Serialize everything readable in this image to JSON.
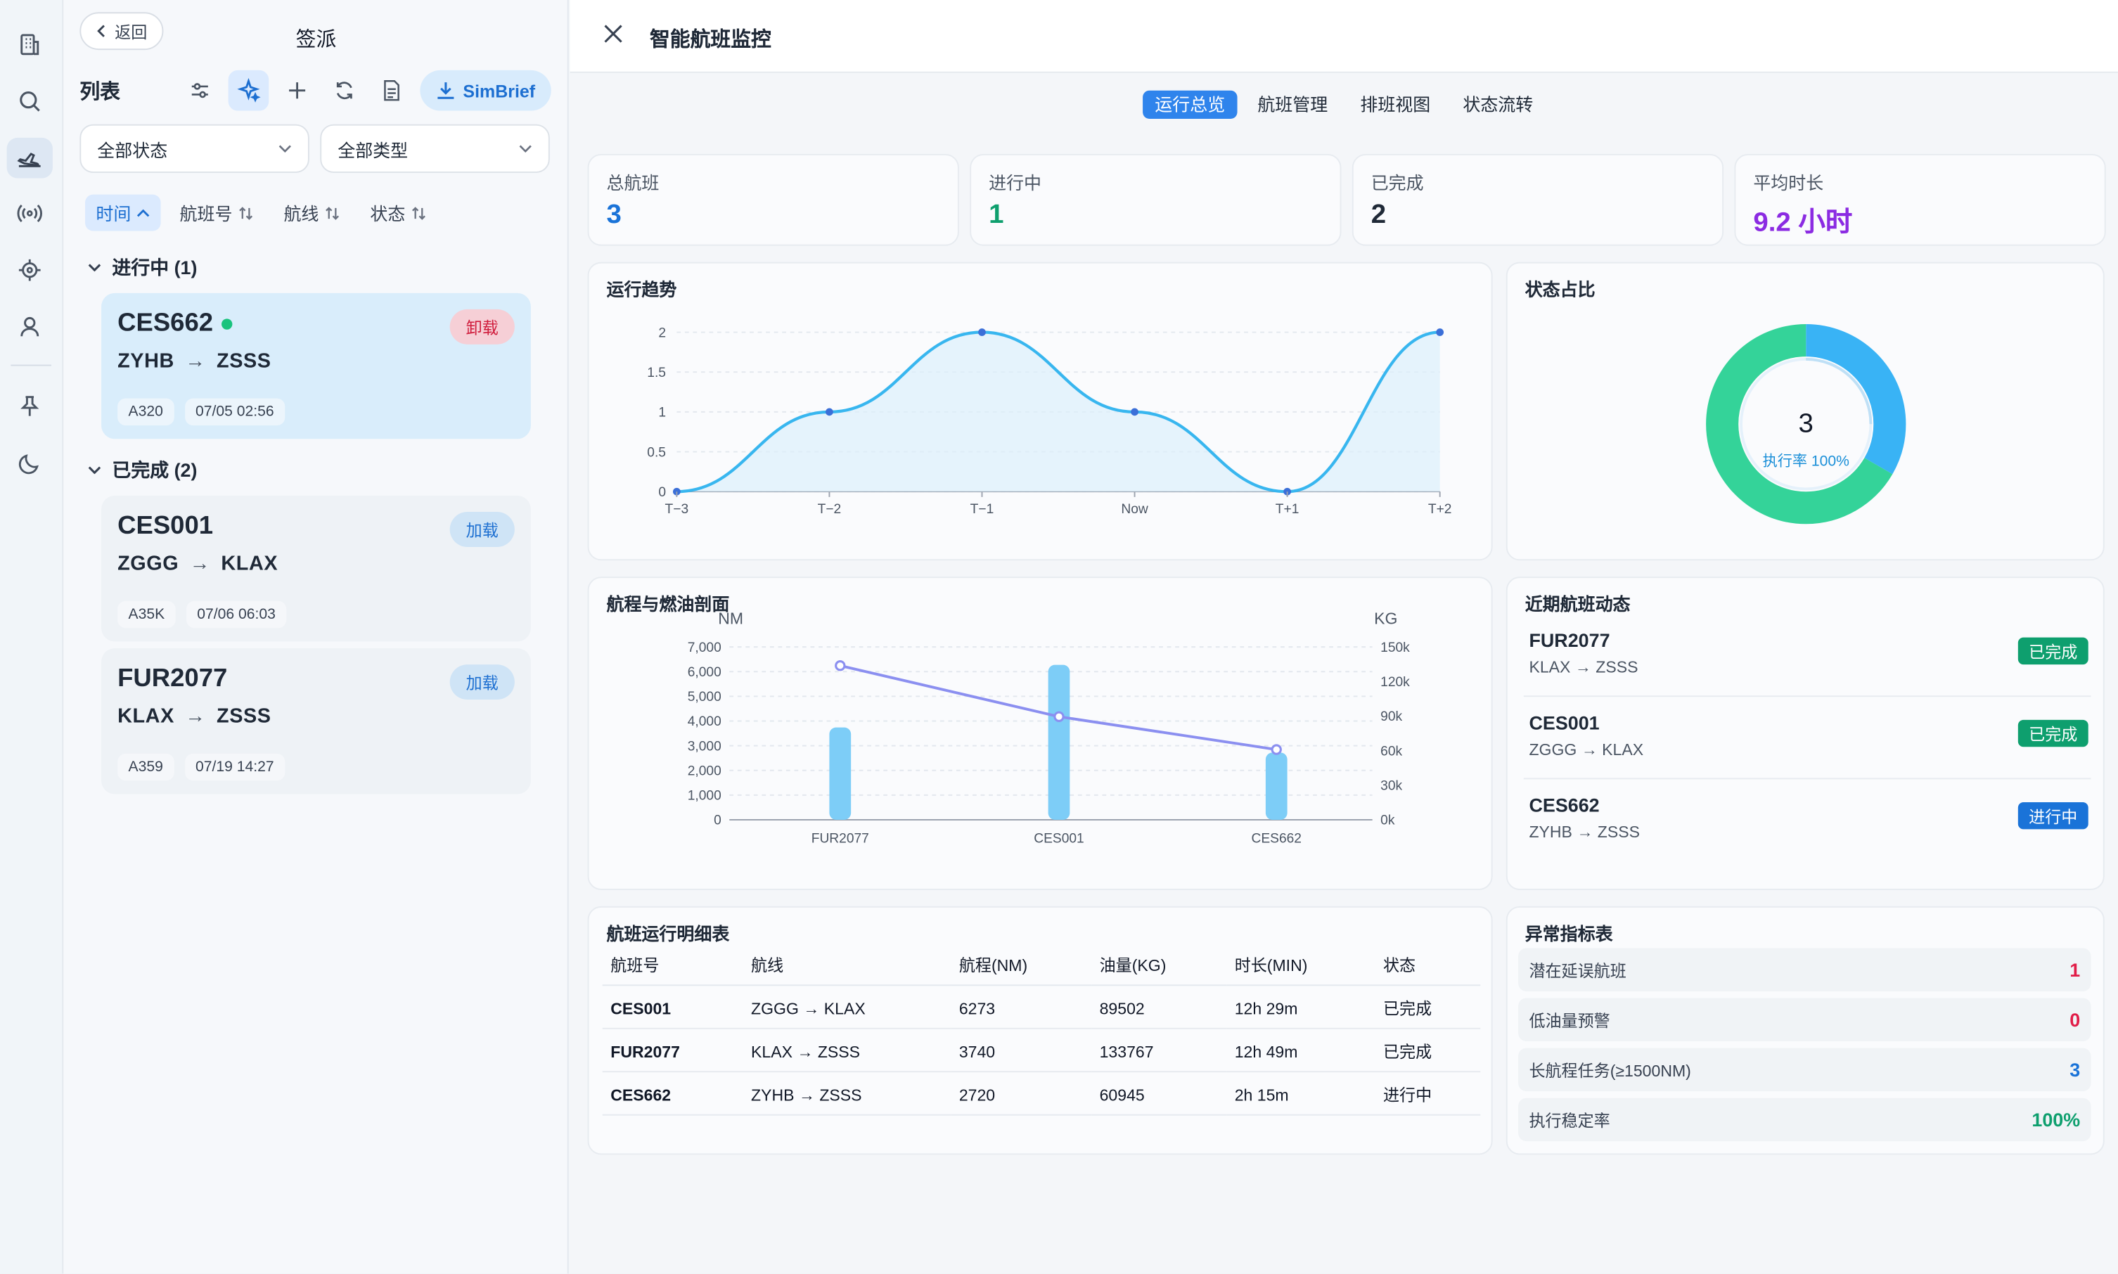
{
  "sidebar": {
    "label": "签派",
    "back_label": "返回",
    "list_label": "列表",
    "simbrief_label": "SimBrief"
  },
  "filters": {
    "status": "全部状态",
    "type": "全部类型"
  },
  "sort_tabs": [
    "时间",
    "航班号",
    "航线",
    "状态"
  ],
  "groups": [
    {
      "title": "进行中 (1)",
      "flights": [
        {
          "flight": "CES662",
          "origin": "ZYHB",
          "dest": "ZSSS",
          "aircraft": "A320",
          "time": "07/05 02:56",
          "badge": "卸载"
        }
      ]
    },
    {
      "title": "已完成 (2)",
      "flights": [
        {
          "flight": "CES001",
          "origin": "ZGGG",
          "dest": "KLAX",
          "aircraft": "A35K",
          "time": "07/06 06:03",
          "badge": "加载"
        },
        {
          "flight": "FUR2077",
          "origin": "KLAX",
          "dest": "ZSSS",
          "aircraft": "A359",
          "time": "07/19 14:27",
          "badge": "加载"
        }
      ]
    }
  ],
  "route_arrow": "→",
  "main": {
    "title": "智能航班监控",
    "tabs": [
      "运行总览",
      "航班管理",
      "排班视图",
      "状态流转"
    ]
  },
  "kpis": [
    {
      "label": "总航班",
      "value": "3",
      "color": "#1a73d8"
    },
    {
      "label": "进行中",
      "value": "1",
      "color": "#0e9f6e"
    },
    {
      "label": "已完成",
      "value": "2",
      "color": "#1f2937"
    },
    {
      "label": "平均时长",
      "value": "9.2 小时",
      "color": "#8b2be2"
    }
  ],
  "panels": {
    "trend": "运行趋势",
    "status": "状态占比",
    "profile": "航程与燃油剖面",
    "recent": "近期航班动态",
    "detail": "航班运行明细表",
    "anomaly": "异常指标表"
  },
  "donut": {
    "total": "3",
    "caption": "执行率 100%"
  },
  "chart_data": [
    {
      "type": "line",
      "x": [
        "T−3",
        "T−2",
        "T−1",
        "Now",
        "T+1",
        "T+2"
      ],
      "values": [
        0,
        1,
        2,
        1,
        0,
        2
      ],
      "ylim": [
        0,
        2
      ],
      "yticks": [
        "0",
        "0.5",
        "1",
        "1.5",
        "2"
      ],
      "color": "#38b6ef"
    },
    {
      "type": "pie",
      "series": [
        {
          "values": [
            1,
            2
          ],
          "colors": [
            "#39b3f5",
            "#34d399"
          ]
        }
      ],
      "center_text": "3"
    },
    {
      "type": "bar",
      "categories": [
        "FUR2077",
        "CES001",
        "CES662"
      ],
      "y_label": "NM",
      "y2_label": "KG",
      "series": [
        {
          "values": [
            3740,
            6273,
            2720
          ],
          "color": "#7dcdf7"
        },
        {
          "values": [
            133767,
            89502,
            60945
          ],
          "color": "#8b8ff0"
        }
      ],
      "ylim": [
        0,
        7000
      ],
      "y2lim": [
        0,
        150000
      ],
      "yticks": [
        "0",
        "1,000",
        "2,000",
        "3,000",
        "4,000",
        "5,000",
        "6,000",
        "7,000"
      ],
      "y2ticks": [
        "0k",
        "30k",
        "60k",
        "90k",
        "120k",
        "150k"
      ]
    }
  ],
  "recent": [
    {
      "flight": "FUR2077",
      "route": "KLAX → ZSSS",
      "status": "已完成",
      "color": "#0e9f6e"
    },
    {
      "flight": "CES001",
      "route": "ZGGG → KLAX",
      "status": "已完成",
      "color": "#0e9f6e"
    },
    {
      "flight": "CES662",
      "route": "ZYHB → ZSSS",
      "status": "进行中",
      "color": "#1a73d8"
    }
  ],
  "table": {
    "headers": [
      "航班号",
      "航线",
      "航程(NM)",
      "油量(KG)",
      "时长(MIN)",
      "状态"
    ],
    "rows": [
      [
        "CES001",
        "ZGGG → KLAX",
        "6273",
        "89502",
        "12h 29m",
        "已完成"
      ],
      [
        "FUR2077",
        "KLAX → ZSSS",
        "3740",
        "133767",
        "12h 49m",
        "已完成"
      ],
      [
        "CES662",
        "ZYHB → ZSSS",
        "2720",
        "60945",
        "2h 15m",
        "进行中"
      ]
    ]
  },
  "anomalies": [
    {
      "label": "潜在延误航班",
      "value": "1",
      "color": "#e11d48"
    },
    {
      "label": "低油量预警",
      "value": "0",
      "color": "#e11d48"
    },
    {
      "label": "长航程任务(≥1500NM)",
      "value": "3",
      "color": "#1a73d8"
    },
    {
      "label": "执行稳定率",
      "value": "100%",
      "color": "#0e9f6e"
    }
  ]
}
